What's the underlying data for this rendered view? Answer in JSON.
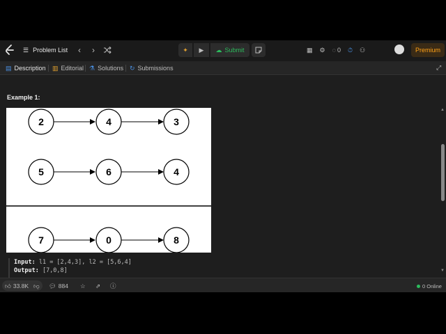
{
  "topbar": {
    "problem_list_label": "Problem List",
    "submit_label": "Submit",
    "streak_count": "0",
    "premium_label": "Premium"
  },
  "tabs": [
    {
      "label": "Description",
      "icon": "description-icon",
      "active": true
    },
    {
      "label": "Editorial",
      "icon": "editorial-icon",
      "active": false
    },
    {
      "label": "Solutions",
      "icon": "solutions-icon",
      "active": false
    },
    {
      "label": "Submissions",
      "icon": "submissions-icon",
      "active": false
    }
  ],
  "content": {
    "example_title": "Example 1:",
    "diagram": {
      "rows": [
        [
          "2",
          "4",
          "3"
        ],
        [
          "5",
          "6",
          "4"
        ],
        [
          "7",
          "0",
          "8"
        ]
      ]
    },
    "input_label": "Input:",
    "input_value": "l1 = [2,4,3], l2 = [5,6,4]",
    "output_label": "Output:",
    "output_value": "[7,0,8]"
  },
  "bottombar": {
    "likes": "33.8K",
    "comments": "884",
    "online": "0 Online"
  },
  "colors": {
    "accent_green": "#2cbb5d",
    "premium_orange": "#ffa116",
    "tab_blue": "#4a90e2"
  }
}
